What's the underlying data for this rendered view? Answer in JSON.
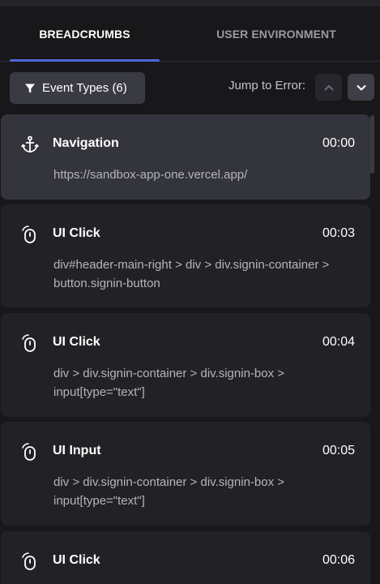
{
  "tabs": [
    {
      "label": "BREADCRUMBS",
      "active": true
    },
    {
      "label": "USER ENVIRONMENT",
      "active": false
    }
  ],
  "toolbar": {
    "filter_label": "Event Types (6)",
    "jump_label": "Jump to Error:",
    "filter_icon": "filter-icon",
    "up_icon": "chevron-up-icon",
    "down_icon": "chevron-down-icon"
  },
  "events": [
    {
      "icon": "anchor-icon",
      "title": "Navigation",
      "time": "00:00",
      "detail": "https://sandbox-app-one.vercel.app/",
      "active": true
    },
    {
      "icon": "mouse-click-icon",
      "title": "UI Click",
      "time": "00:03",
      "detail": "div#header-main-right > div > div.signin-container > button.signin-button",
      "active": false
    },
    {
      "icon": "mouse-click-icon",
      "title": "UI Click",
      "time": "00:04",
      "detail": "div > div.signin-container > div.signin-box > input[type=\"text\"]",
      "active": false
    },
    {
      "icon": "mouse-click-icon",
      "title": "UI Input",
      "time": "00:05",
      "detail": "div > div.signin-container > div.signin-box > input[type=\"text\"]",
      "active": false
    },
    {
      "icon": "mouse-click-icon",
      "title": "UI Click",
      "time": "00:06",
      "detail": "",
      "active": false
    }
  ],
  "colors": {
    "background": "#18181b",
    "card": "#222226",
    "card_active": "#34353c",
    "accent": "#4f67d8"
  }
}
